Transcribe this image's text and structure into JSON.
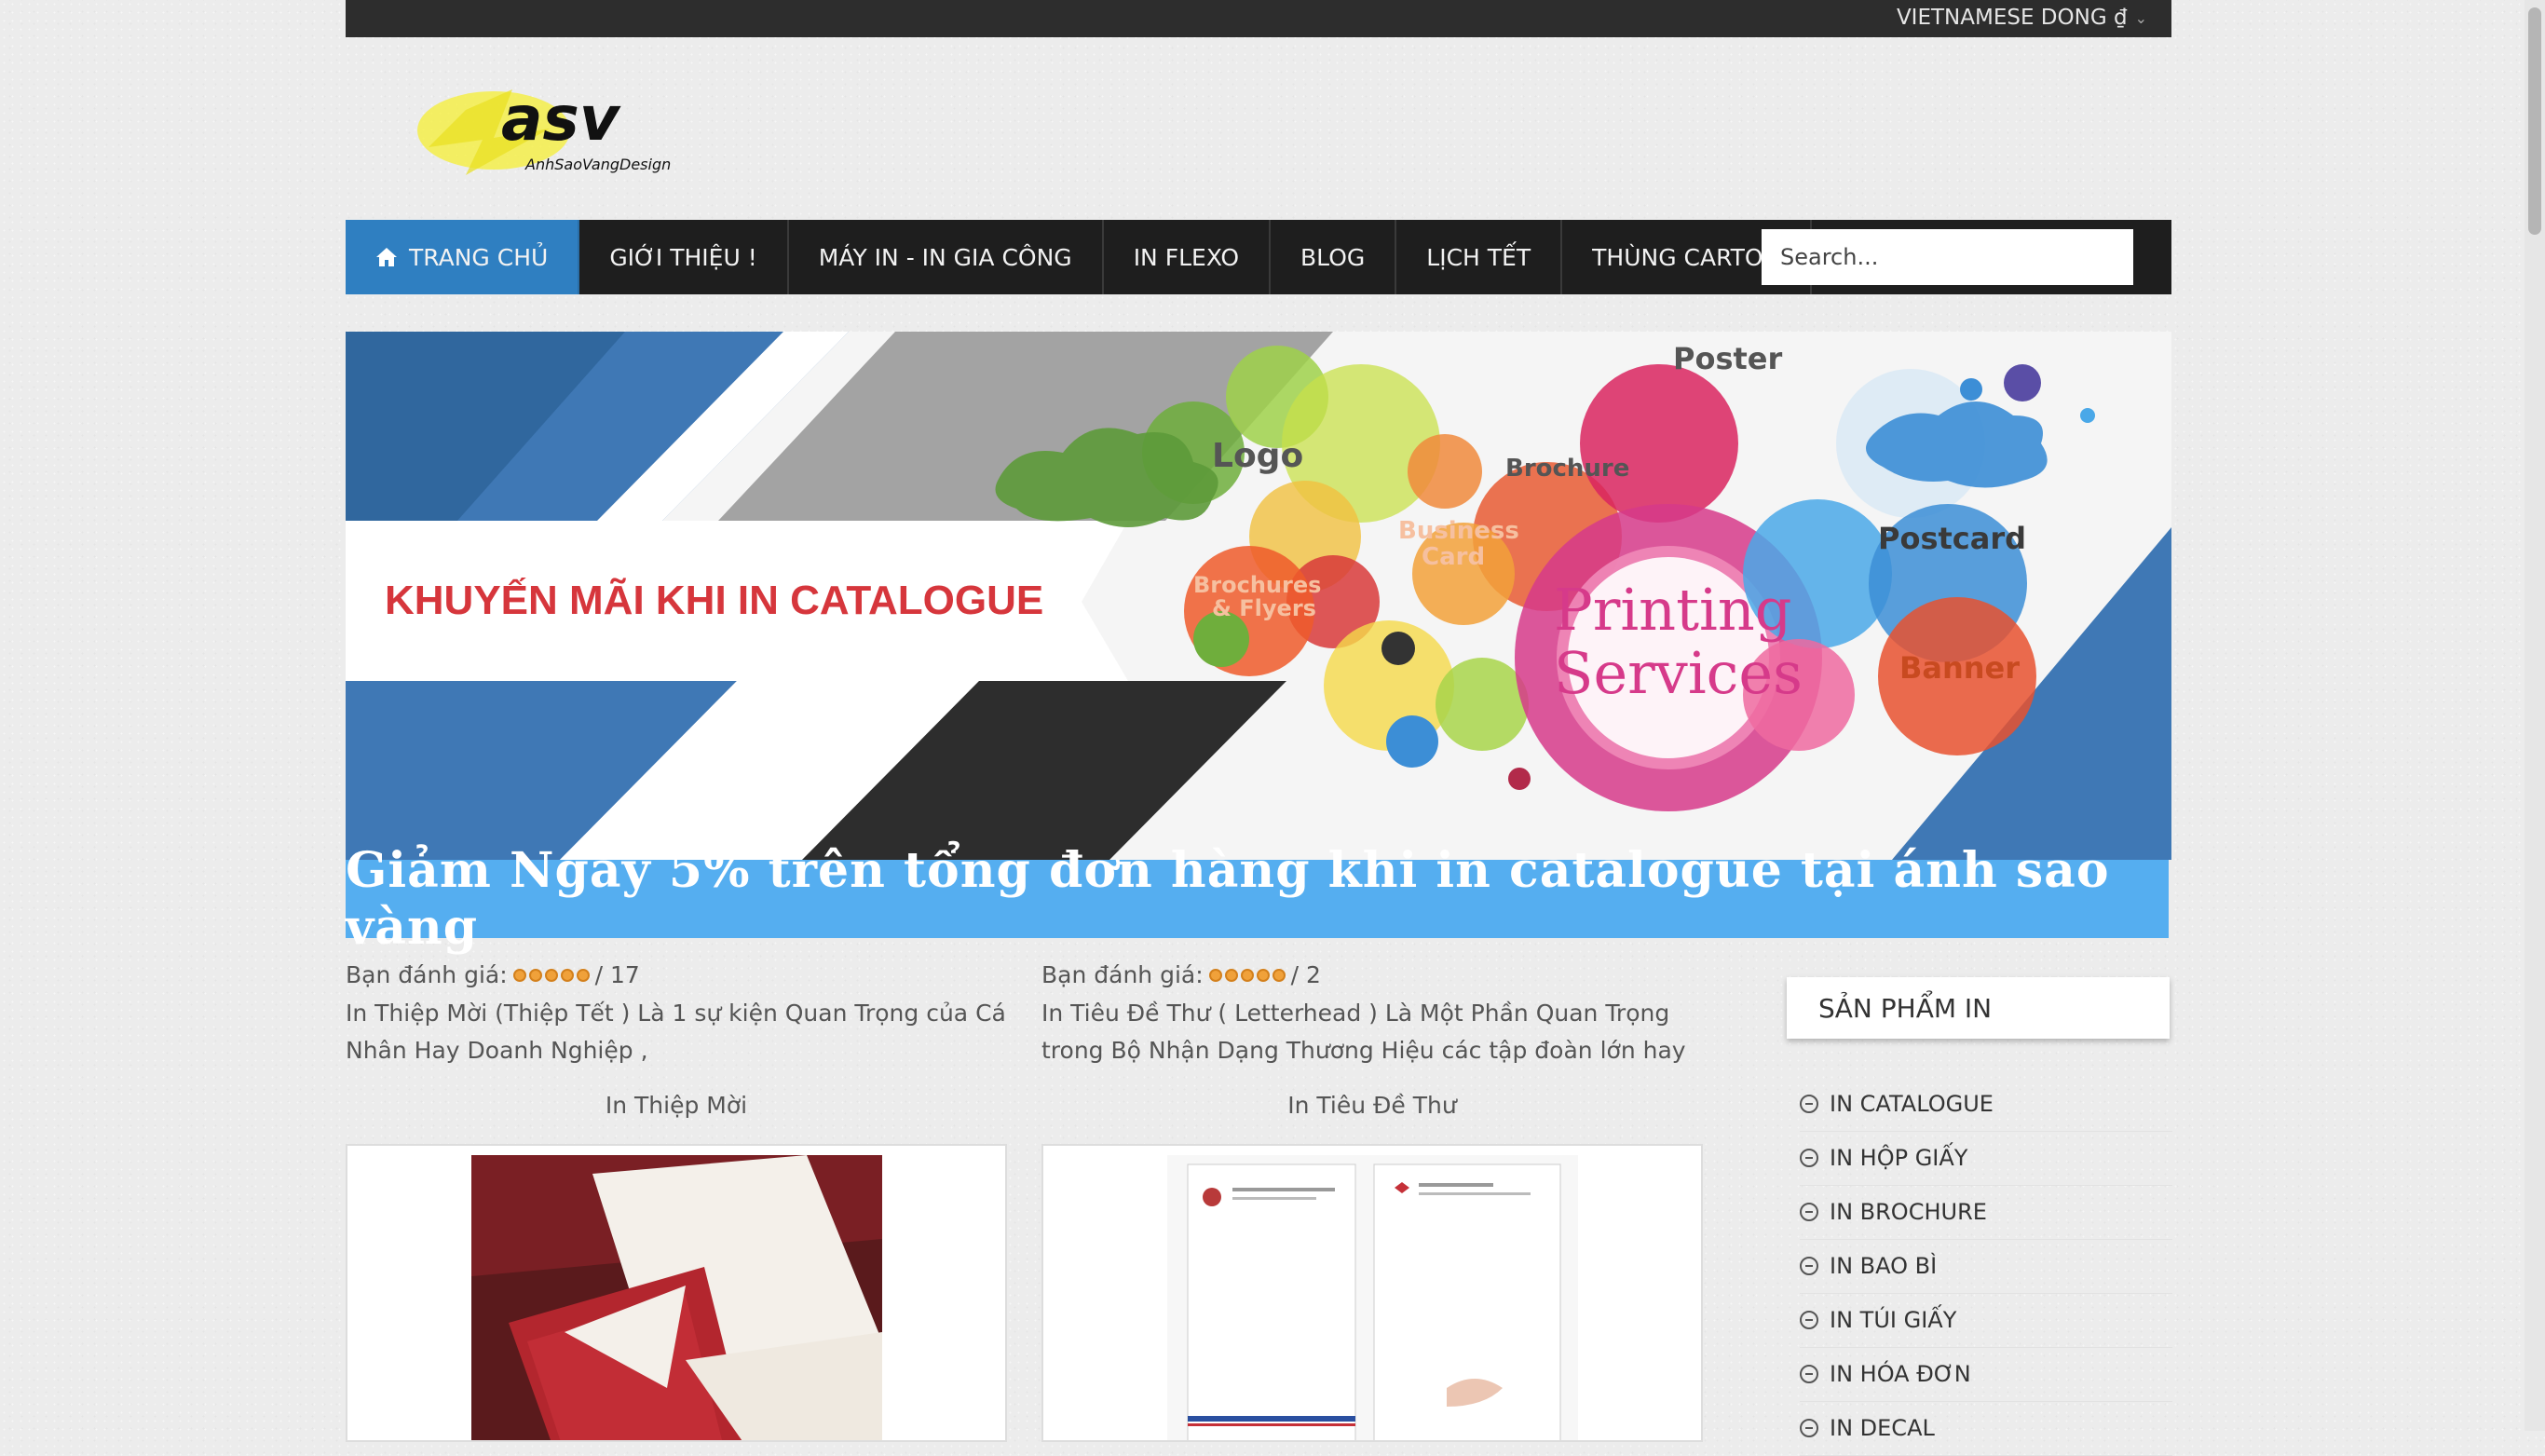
{
  "topbar": {
    "currency": "VIETNAMESE DONG ₫"
  },
  "logo": {
    "mark": "asv",
    "tagline": "AnhSaoVangDesign"
  },
  "nav": {
    "items": [
      {
        "label": "TRANG CHỦ",
        "active": true
      },
      {
        "label": "GIỚI THIỆU !"
      },
      {
        "label": "MÁY IN - IN GIA CÔNG"
      },
      {
        "label": "IN FLEXO"
      },
      {
        "label": "BLOG"
      },
      {
        "label": "LỊCH TẾT"
      },
      {
        "label": "THÙNG CARTON"
      }
    ],
    "search_placeholder": "Search..."
  },
  "banner": {
    "headline": "KHUYẾN MÃI KHI IN CATALOGUE",
    "bubbles": {
      "logo": "Logo",
      "poster": "Poster",
      "brochure": "Brochure",
      "business1": "Business",
      "business2": "Card",
      "brochures1": "Brochures",
      "brochures2": "& Flyers",
      "postcard": "Postcard",
      "banner": "Banner",
      "printing": "Printing",
      "services": "Services"
    },
    "caption": "Giảm Ngay 5% trên tổng đơn hàng khi in catalogue tại ánh sao vàng"
  },
  "articles": [
    {
      "rating_label": "Bạn đánh giá:",
      "rating_count": "/ 17",
      "excerpt": "In Thiệp Mời (Thiệp Tết ) Là 1 sự kiện Quan Trọng của Cá Nhân Hay Doanh Nghiệp ,",
      "title": "In Thiệp Mời"
    },
    {
      "rating_label": "Bạn đánh giá:",
      "rating_count": "/ 2",
      "excerpt": "In Tiêu Đề Thư ( Letterhead ) Là Một Phần Quan Trọng trong Bộ Nhận Dạng Thương Hiệu các tập đoàn lớn hay",
      "title": "In Tiêu Đề Thư"
    }
  ],
  "sidebar": {
    "heading": "SẢN PHẨM IN",
    "items": [
      "IN CATALOGUE",
      "IN HỘP GIẤY",
      "IN BROCHURE",
      "IN BAO BÌ",
      "IN TÚI GIẤY",
      "IN HÓA ĐƠN",
      "IN DECAL"
    ]
  },
  "colors": {
    "accent": "#2f7fc1",
    "caption_bg": "#55aef0",
    "headline_red": "#d6363c"
  }
}
